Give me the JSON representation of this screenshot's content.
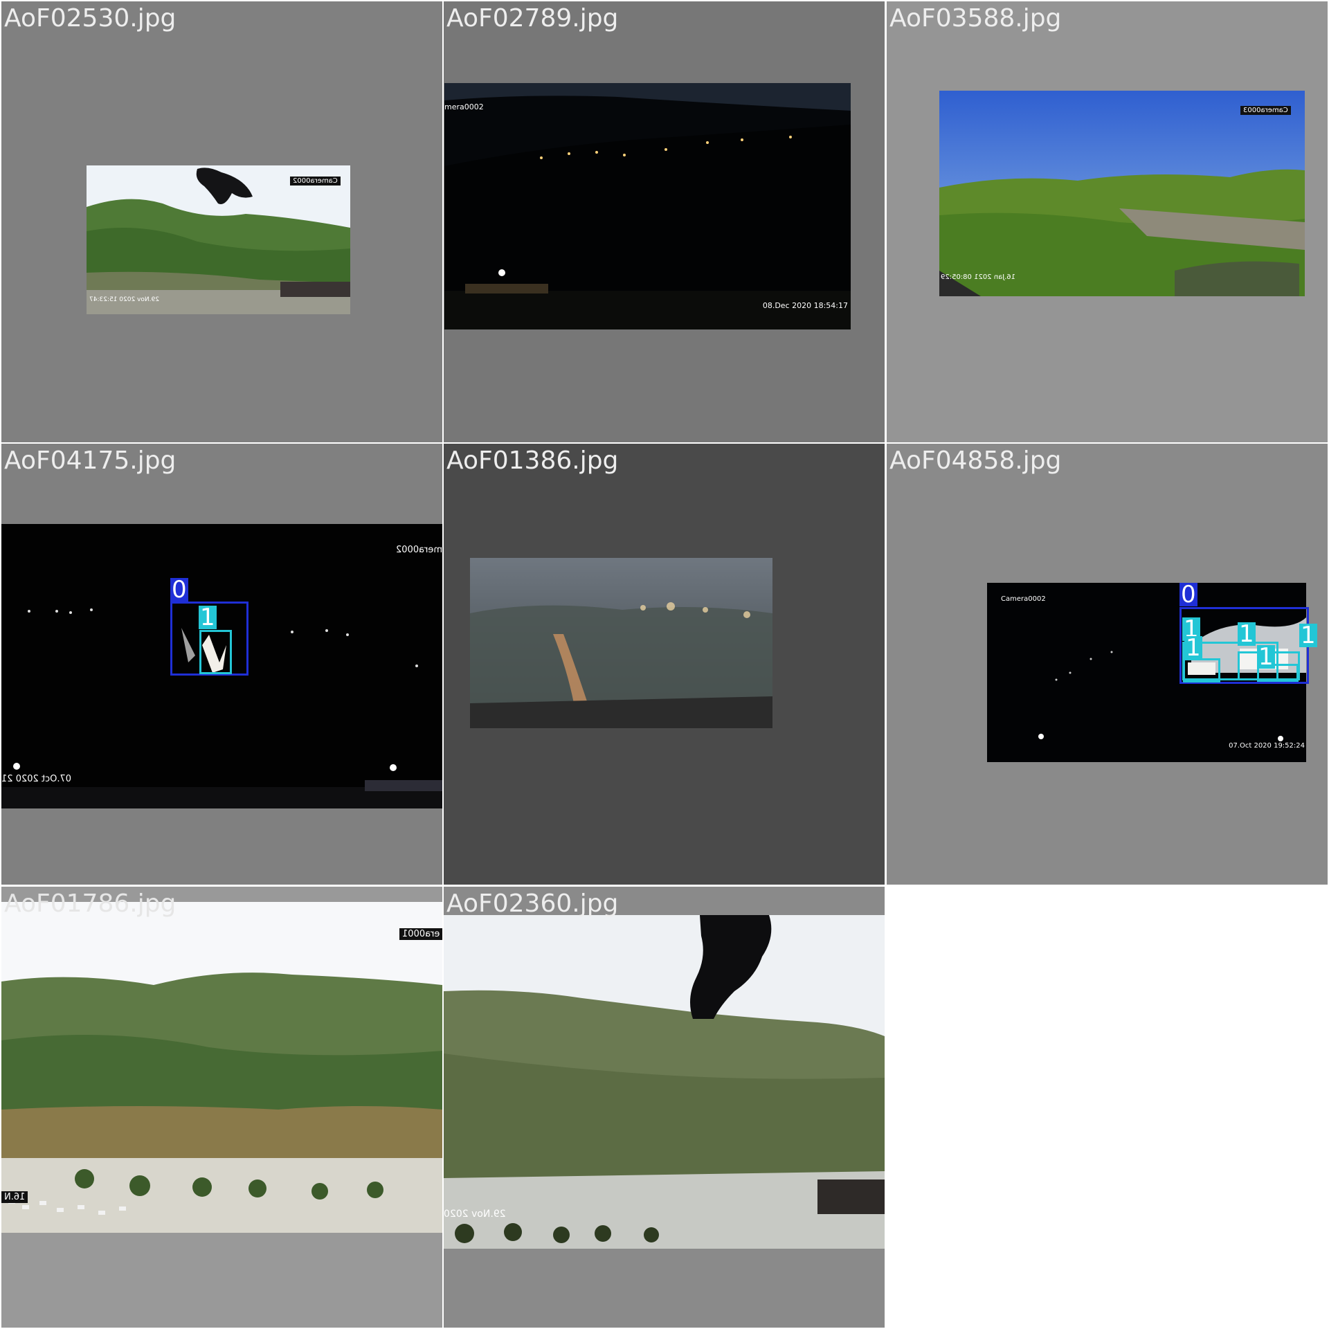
{
  "tiles": [
    {
      "filename": "AoF02530.jpg",
      "background": "#808080",
      "stamps": {
        "camera": "Camera0002",
        "datetime": "29.Nov 2020  15:23:47"
      }
    },
    {
      "filename": "AoF02789.jpg",
      "background": "#777777",
      "stamps": {
        "camera": "mera0002",
        "datetime": "08.Dec 2020   18:54:17"
      }
    },
    {
      "filename": "AoF03588.jpg",
      "background": "#959595",
      "stamps": {
        "camera": "Camera0003",
        "datetime": "16.Jan 2021  08:05:29"
      }
    },
    {
      "filename": "AoF04175.jpg",
      "background": "#808080",
      "stamps": {
        "camera": "mera0002",
        "datetime": "07.Oct 2020  21"
      },
      "labels": {
        "smoke": "0",
        "fire": "1"
      }
    },
    {
      "filename": "AoF01386.jpg",
      "background": "#4a4a4a"
    },
    {
      "filename": "AoF04858.jpg",
      "background": "#8a8a8a",
      "stamps": {
        "camera": "Camera0002",
        "datetime": "07.Oct 2020   19:52:24"
      },
      "labels": {
        "smoke": "0",
        "fire": "1"
      }
    },
    {
      "filename": "AoF01786.jpg",
      "background": "#999999",
      "stamps": {
        "camera": "era0001",
        "datetime": "16.N"
      }
    },
    {
      "filename": "AoF02360.jpg",
      "background": "#8a8a8a",
      "stamps": {
        "datetime": "29.Nov 2020"
      }
    }
  ],
  "colors": {
    "smoke_box": "#1f2fd6",
    "fire_box": "#23c6d6"
  }
}
